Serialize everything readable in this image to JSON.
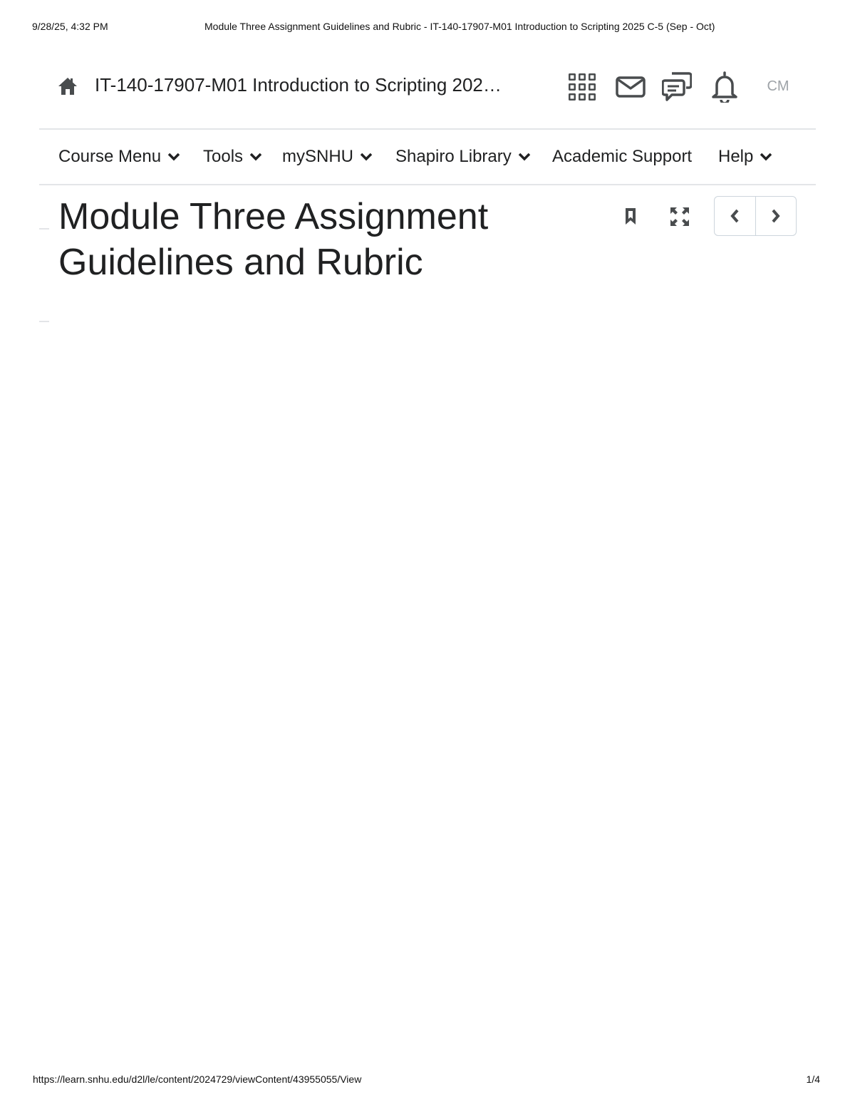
{
  "print": {
    "datetime": "9/28/25, 4:32 PM",
    "document_title": "Module Three Assignment Guidelines and Rubric - IT-140-17907-M01 Introduction to Scripting 2025 C-5 (Sep - Oct)",
    "url": "https://learn.snhu.edu/d2l/le/content/2024729/viewContent/43955055/View",
    "page_indicator": "1/4"
  },
  "header": {
    "course_title": "IT-140-17907-M01 Introduction to Scripting 202…",
    "user_initials": "CM",
    "icons": [
      "home-icon",
      "waffle-grid-icon",
      "mail-icon",
      "chat-icon",
      "bell-icon"
    ]
  },
  "nav": {
    "items": [
      {
        "label": "Course Menu",
        "has_dropdown": true
      },
      {
        "label": "Tools",
        "has_dropdown": true
      },
      {
        "label": "mySNHU",
        "has_dropdown": true
      },
      {
        "label": "Shapiro Library",
        "has_dropdown": true
      },
      {
        "label": "Academic Support",
        "has_dropdown": false
      },
      {
        "label": "Help",
        "has_dropdown": true
      }
    ]
  },
  "content": {
    "title": "Module Three Assignment Guidelines and Rubric",
    "icons": [
      "bookmark-icon",
      "fullscreen-icon",
      "chevron-left-icon",
      "chevron-right-icon"
    ]
  },
  "colors": {
    "text": "#202122",
    "icon": "#494c4e",
    "muted": "#9ea3a8",
    "divider": "#e3e5e8"
  }
}
